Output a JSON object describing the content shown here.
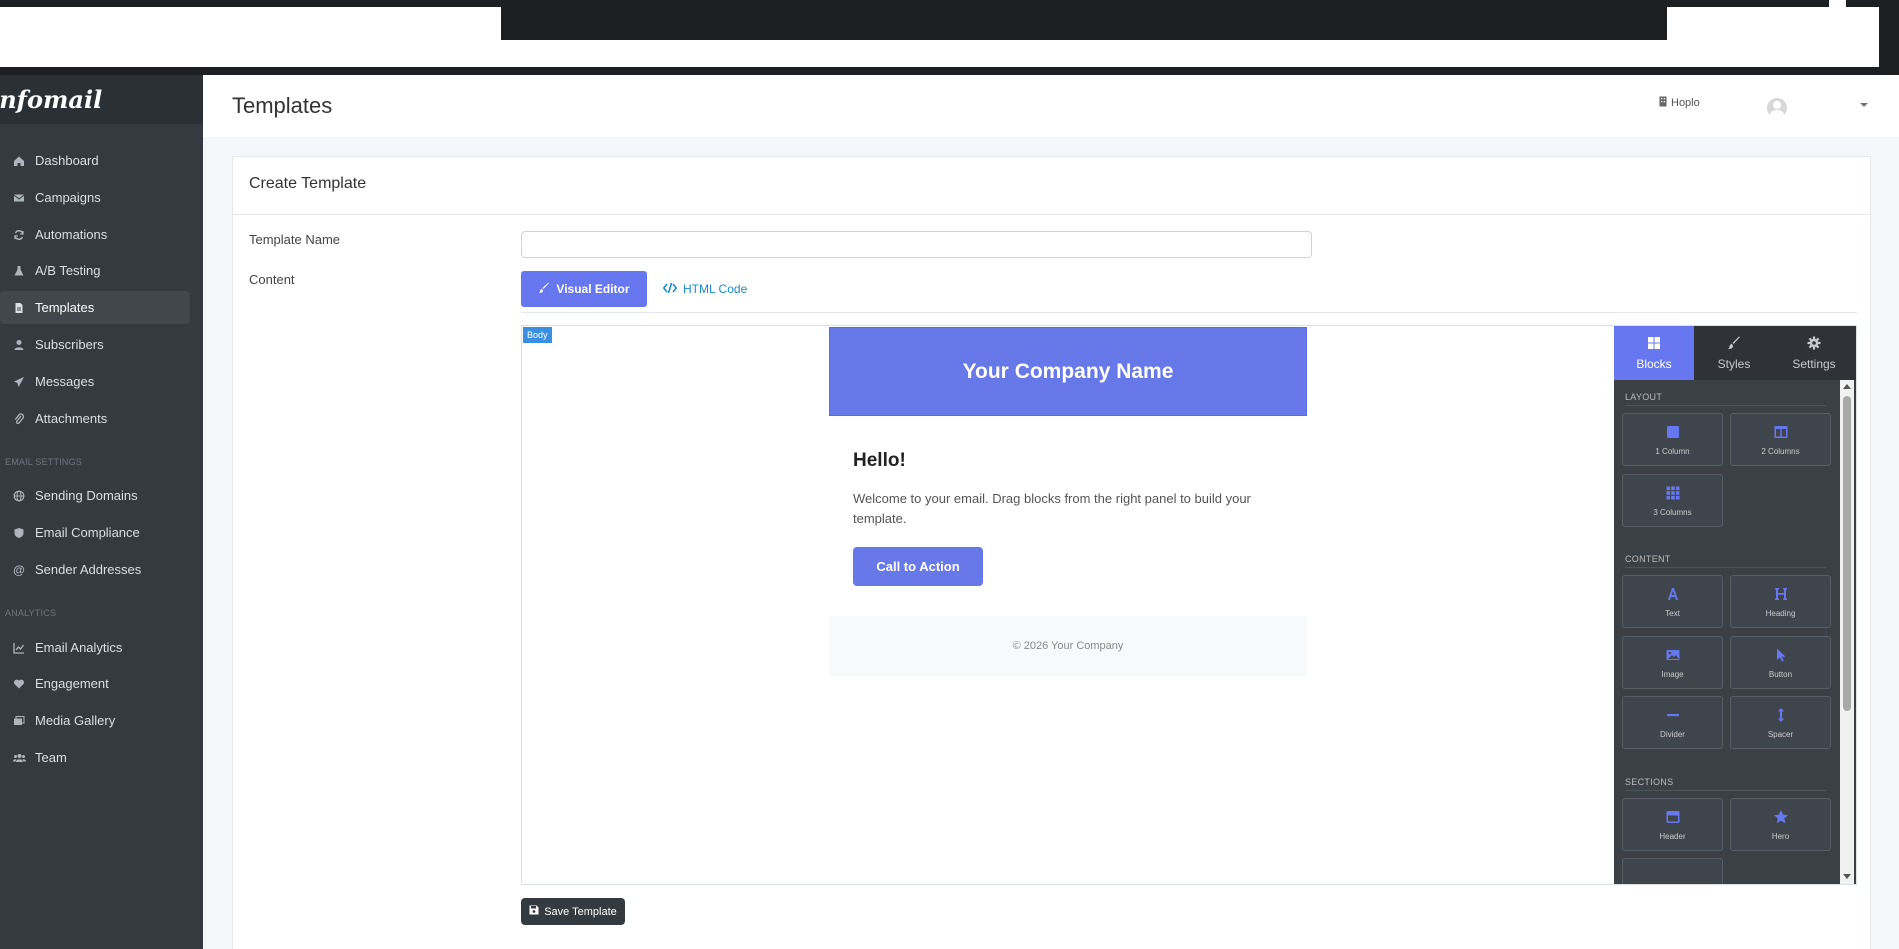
{
  "app": {
    "brand": "Infomail"
  },
  "sidebar": {
    "items": [
      {
        "label": "Dashboard",
        "icon": "home-icon"
      },
      {
        "label": "Campaigns",
        "icon": "envelope-icon"
      },
      {
        "label": "Automations",
        "icon": "sync-icon"
      },
      {
        "label": "A/B Testing",
        "icon": "flask-icon"
      },
      {
        "label": "Templates",
        "icon": "file-icon",
        "active": true
      },
      {
        "label": "Subscribers",
        "icon": "user-icon"
      },
      {
        "label": "Messages",
        "icon": "paper-plane-icon"
      },
      {
        "label": "Attachments",
        "icon": "paperclip-icon"
      }
    ],
    "email_settings_header": "EMAIL SETTINGS",
    "email_settings": [
      {
        "label": "Sending Domains",
        "icon": "globe-icon"
      },
      {
        "label": "Email Compliance",
        "icon": "shield-icon"
      },
      {
        "label": "Sender Addresses",
        "icon": "at-icon"
      }
    ],
    "analytics_header": "ANALYTICS",
    "analytics": [
      {
        "label": "Email Analytics",
        "icon": "chart-line-icon"
      },
      {
        "label": "Engagement",
        "icon": "heart-icon"
      },
      {
        "label": "Media Gallery",
        "icon": "images-icon"
      },
      {
        "label": "Team",
        "icon": "users-icon"
      }
    ]
  },
  "header": {
    "title": "Templates",
    "organization": "Hoplo"
  },
  "form": {
    "card_title": "Create Template",
    "name_label": "Template Name",
    "name_value": "",
    "content_label": "Content",
    "tab_visual": "Visual Editor",
    "tab_html": "HTML Code",
    "save_label": "Save Template"
  },
  "editor": {
    "body_badge": "Body",
    "email": {
      "company": "Your Company Name",
      "greeting": "Hello!",
      "text": "Welcome to your email. Drag blocks from the right panel to build your template.",
      "cta": "Call to Action",
      "footer": "© 2026 Your Company"
    },
    "panel": {
      "tabs": [
        "Blocks",
        "Styles",
        "Settings"
      ],
      "layout_title": "LAYOUT",
      "layout": [
        "1 Column",
        "2 Columns",
        "3 Columns"
      ],
      "content_title": "CONTENT",
      "content": [
        "Text",
        "Heading",
        "Image",
        "Button",
        "Divider",
        "Spacer"
      ],
      "sections_title": "SECTIONS",
      "sections": [
        "Header",
        "Hero"
      ]
    }
  },
  "colors": {
    "accent": "#6777ef",
    "email_header": "#6779e9",
    "sidebar": "#343a40",
    "link": "#1a8ccf"
  }
}
